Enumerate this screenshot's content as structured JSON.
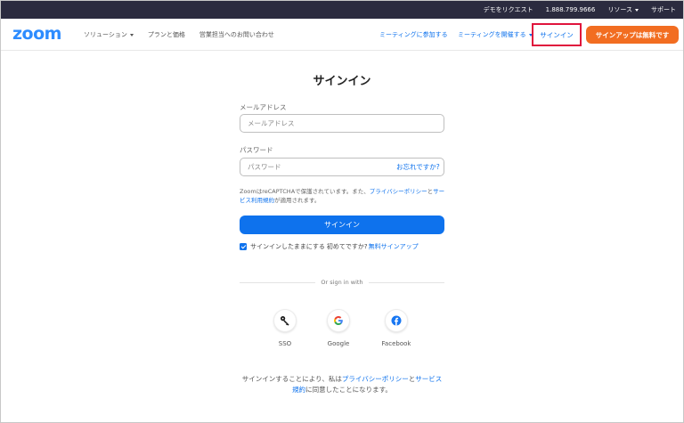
{
  "topbar": {
    "request_demo": "デモをリクエスト",
    "phone": "1.888.799.9666",
    "resources": "リソース",
    "support": "サポート"
  },
  "nav": {
    "logo": "zoom",
    "solutions": "ソリューション",
    "plans": "プランと価格",
    "contact_sales": "営業担当へのお問い合わせ",
    "join_meeting": "ミーティングに参加する",
    "host_meeting": "ミーティングを開催する",
    "sign_in": "サインイン",
    "sign_up": "サインアップは無料です"
  },
  "form": {
    "title": "サインイン",
    "email_label": "メールアドレス",
    "email_placeholder": "メールアドレス",
    "password_label": "パスワード",
    "password_placeholder": "パスワード",
    "forgot": "お忘れですか?",
    "captcha_prefix": "ZoomはreCAPTCHAで保護されています。また、",
    "privacy_link": "プライバシーポリシー",
    "captcha_and": "と",
    "terms_link": "サービス利用規約",
    "captcha_suffix": "が適用されます。",
    "submit": "サインイン",
    "stay_signed_in": "サインインしたままにする",
    "new_prompt": "初めてですか?",
    "free_signup": "無料サインアップ"
  },
  "divider": {
    "text": "Or sign in with"
  },
  "social": {
    "sso": "SSO",
    "google": "Google",
    "facebook": "Facebook"
  },
  "footer": {
    "prefix": "サインインすることにより、私は",
    "privacy": "プライバシーポリシー",
    "and": "と",
    "terms_line1": "サービス",
    "terms_line2": "規約",
    "suffix": "に同意したことになります。"
  },
  "colors": {
    "accent": "#0e72ed",
    "signup_orange": "#f26d21",
    "highlight_red": "#e0143c",
    "topbar": "#2b2b3f"
  }
}
